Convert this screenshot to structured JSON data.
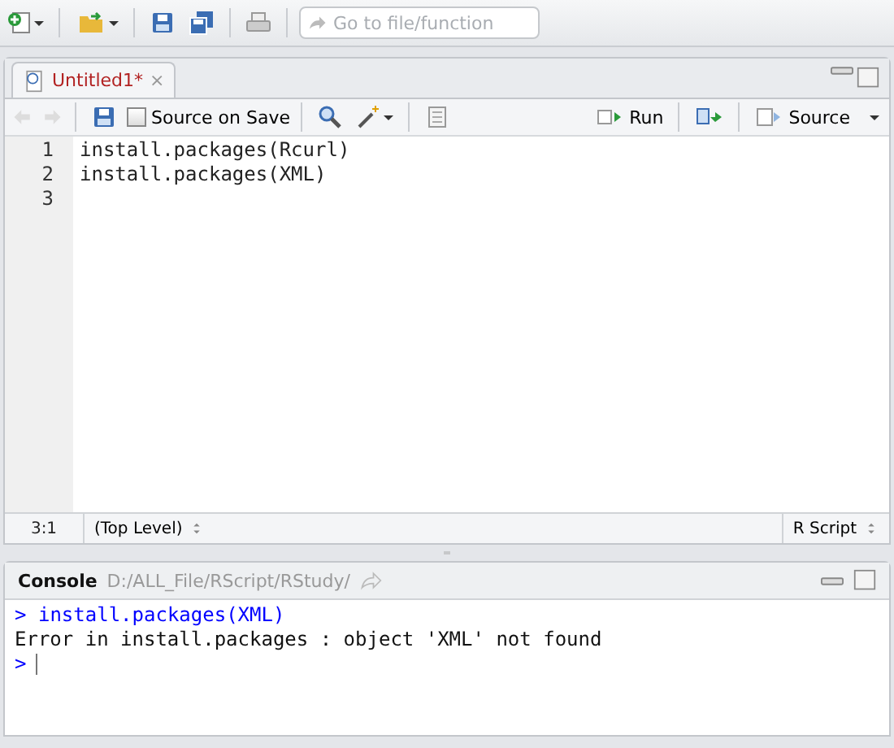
{
  "toolbar": {
    "search": {
      "placeholder": "Go to file/function"
    }
  },
  "editor": {
    "tabs": [
      {
        "label": "Untitled1*",
        "close": "×",
        "selected": true
      }
    ],
    "source_on_save": {
      "label": "Source on Save",
      "checked": false
    },
    "run": "Run",
    "source": "Source",
    "lines": [
      {
        "number": "1",
        "code": "install.packages(Rcurl)"
      },
      {
        "number": "2",
        "code": "install.packages(XML)"
      },
      {
        "number": "3"
      }
    ],
    "status": {
      "position": "3:1",
      "scope": "(Top Level)",
      "file_type": "R Script"
    }
  },
  "console": {
    "title": "Console",
    "path": "D:/ALL_File/RScript/RStudy/",
    "lines": [
      {
        "kind": "input",
        "prompt": ">",
        "text": "install.packages(XML)"
      },
      {
        "kind": "error",
        "text": "Error in install.packages : object 'XML' not found"
      },
      {
        "kind": "prompt",
        "prompt": ">"
      }
    ]
  }
}
